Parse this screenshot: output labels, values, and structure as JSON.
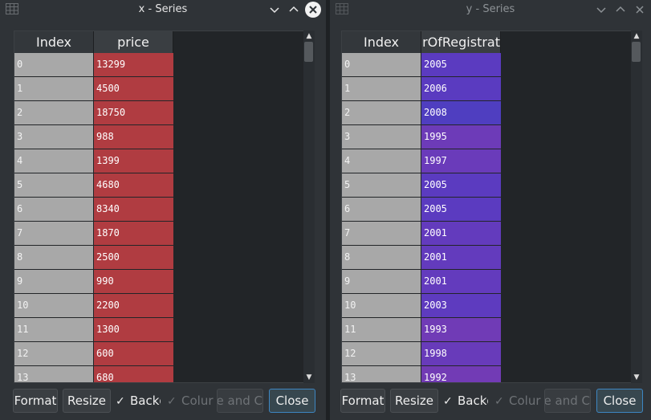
{
  "left_window": {
    "title": "x - Series",
    "header_index": "Index",
    "header_column": "price",
    "cell_color": "#b03c41",
    "rows": [
      {
        "index": "0",
        "value": "13299"
      },
      {
        "index": "1",
        "value": "4500"
      },
      {
        "index": "2",
        "value": "18750"
      },
      {
        "index": "3",
        "value": "988"
      },
      {
        "index": "4",
        "value": "1399"
      },
      {
        "index": "5",
        "value": "4680"
      },
      {
        "index": "6",
        "value": "8340"
      },
      {
        "index": "7",
        "value": "1870"
      },
      {
        "index": "8",
        "value": "2500"
      },
      {
        "index": "9",
        "value": "990"
      },
      {
        "index": "10",
        "value": "2200"
      },
      {
        "index": "11",
        "value": "1300"
      },
      {
        "index": "12",
        "value": "600"
      },
      {
        "index": "13",
        "value": "680"
      }
    ],
    "buttons": {
      "format": "Format",
      "resize": "Resize",
      "background": "Backg",
      "column_min_max": "Colur",
      "columns_and_cells": "e and C",
      "close": "Close"
    }
  },
  "right_window": {
    "title": "y - Series",
    "header_index": "Index",
    "header_column": "arOfRegistrat",
    "rows": [
      {
        "index": "0",
        "value": "2005",
        "color": "#5b3bc0"
      },
      {
        "index": "1",
        "value": "2006",
        "color": "#5a3bc0"
      },
      {
        "index": "2",
        "value": "2008",
        "color": "#4f3ec0"
      },
      {
        "index": "3",
        "value": "1995",
        "color": "#6d3bb8"
      },
      {
        "index": "4",
        "value": "1997",
        "color": "#6a3bba"
      },
      {
        "index": "5",
        "value": "2005",
        "color": "#5b3bc0"
      },
      {
        "index": "6",
        "value": "2005",
        "color": "#5b3bc0"
      },
      {
        "index": "7",
        "value": "2001",
        "color": "#633bbd"
      },
      {
        "index": "8",
        "value": "2001",
        "color": "#633bbd"
      },
      {
        "index": "9",
        "value": "2001",
        "color": "#633bbd"
      },
      {
        "index": "10",
        "value": "2003",
        "color": "#5e3bbf"
      },
      {
        "index": "11",
        "value": "1993",
        "color": "#703bb6"
      },
      {
        "index": "12",
        "value": "1998",
        "color": "#683bba"
      },
      {
        "index": "13",
        "value": "1992",
        "color": "#723bb5"
      }
    ],
    "buttons": {
      "format": "Format",
      "resize": "Resize",
      "background": "Backg",
      "column_min_max": "Colur",
      "columns_and_cells": "e and C",
      "close": "Close"
    }
  },
  "icons": {
    "app": "table-grid-icon",
    "minimize": "chevron-down-icon",
    "maximize": "chevron-up-icon",
    "close": "close-icon",
    "checkmark": "check-icon"
  }
}
